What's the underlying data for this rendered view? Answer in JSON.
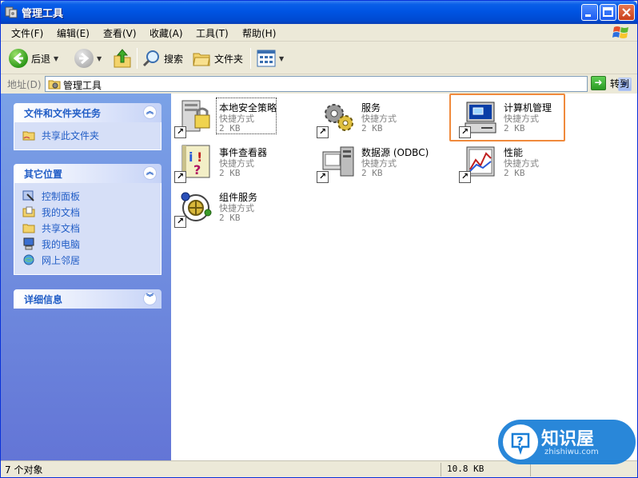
{
  "window": {
    "title": "管理工具"
  },
  "menu": [
    "文件(F)",
    "编辑(E)",
    "查看(V)",
    "收藏(A)",
    "工具(T)",
    "帮助(H)"
  ],
  "toolbar": {
    "back_label": "后退",
    "search_label": "搜索",
    "folders_label": "文件夹"
  },
  "address": {
    "label": "地址(D)",
    "value": "管理工具",
    "go_label": "转到"
  },
  "taskpane": {
    "file_tasks": {
      "title": "文件和文件夹任务",
      "items": [
        {
          "label": "共享此文件夹",
          "icon": "share-folder-icon"
        }
      ]
    },
    "other_places": {
      "title": "其它位置",
      "items": [
        {
          "label": "控制面板",
          "icon": "control-panel-icon"
        },
        {
          "label": "我的文档",
          "icon": "my-documents-icon"
        },
        {
          "label": "共享文档",
          "icon": "shared-documents-icon"
        },
        {
          "label": "我的电脑",
          "icon": "my-computer-icon"
        },
        {
          "label": "网上邻居",
          "icon": "network-places-icon"
        }
      ]
    },
    "details": {
      "title": "详细信息"
    }
  },
  "items": [
    {
      "name": "本地安全策略",
      "type": "快捷方式",
      "size": "2 KB",
      "icon": "local-security-policy-icon"
    },
    {
      "name": "服务",
      "type": "快捷方式",
      "size": "2 KB",
      "icon": "services-icon"
    },
    {
      "name": "计算机管理",
      "type": "快捷方式",
      "size": "2 KB",
      "icon": "computer-management-icon"
    },
    {
      "name": "事件查看器",
      "type": "快捷方式",
      "size": "2 KB",
      "icon": "event-viewer-icon"
    },
    {
      "name": "数据源 (ODBC)",
      "type": "快捷方式",
      "size": "2 KB",
      "icon": "odbc-data-source-icon"
    },
    {
      "name": "性能",
      "type": "快捷方式",
      "size": "2 KB",
      "icon": "performance-icon"
    },
    {
      "name": "组件服务",
      "type": "快捷方式",
      "size": "2 KB",
      "icon": "component-services-icon"
    }
  ],
  "status": {
    "count": "7 个对象",
    "size": "10.8 KB"
  },
  "watermark": {
    "title": "知识屋",
    "url": "zhishiwu.com"
  },
  "colors": {
    "title_blue": "#0054e3",
    "taskpane_blue": "#6375d6",
    "highlight_orange": "#f08a3c",
    "link_blue": "#215dc6"
  }
}
